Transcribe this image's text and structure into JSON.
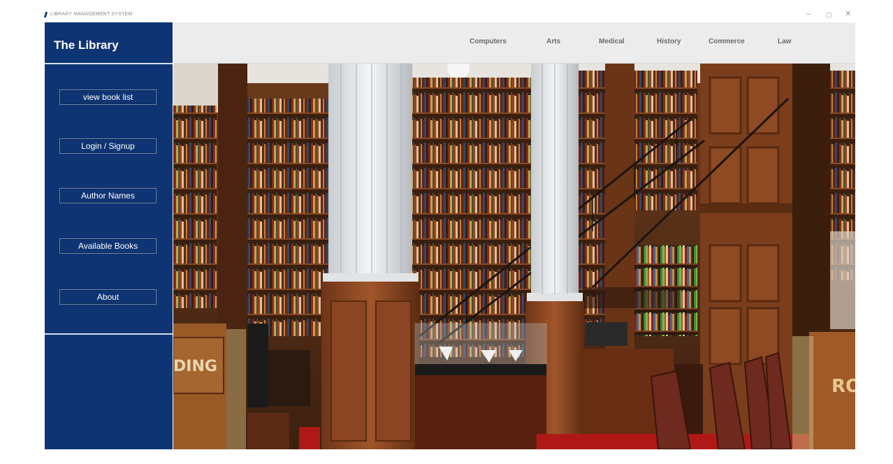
{
  "window": {
    "title": "LIBRARY MANAGEMENT SYSTEM",
    "controls": {
      "minimize": "–",
      "maximize": "▢",
      "close": "✕"
    }
  },
  "sidebar": {
    "title": "The Library",
    "buttons": [
      {
        "label": "view book list"
      },
      {
        "label": "Login / Signup"
      },
      {
        "label": "Author Names"
      },
      {
        "label": "Available Books"
      },
      {
        "label": "About"
      }
    ]
  },
  "categories": [
    {
      "label": "Computers"
    },
    {
      "label": "Arts"
    },
    {
      "label": "Medical"
    },
    {
      "label": "History"
    },
    {
      "label": "Commerce"
    },
    {
      "label": "Law"
    }
  ],
  "hero": {
    "signs": {
      "left": "DING",
      "right": "RO"
    }
  },
  "colors": {
    "sidebar": "#0f3473",
    "topbar": "#ececec",
    "category_text": "#6a6a6a"
  }
}
